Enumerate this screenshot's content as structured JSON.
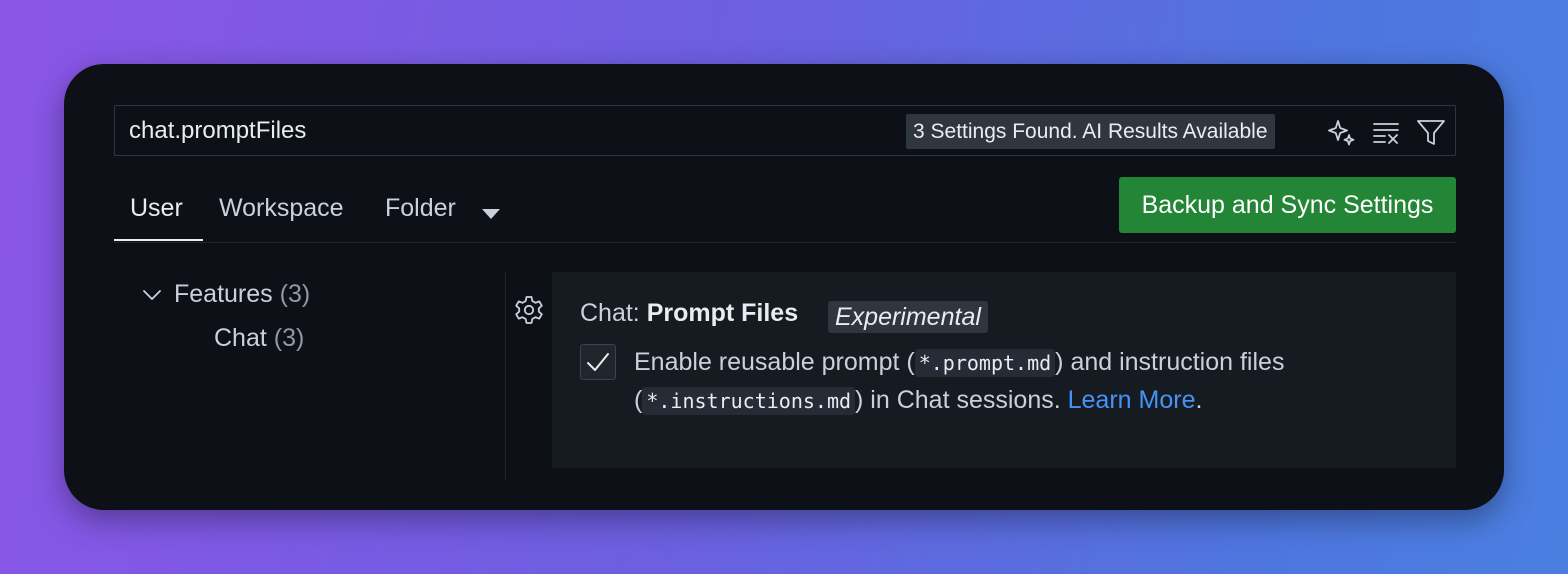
{
  "search": {
    "value": "chat.promptFiles",
    "results_label": "3 Settings Found. AI Results Available",
    "icons": [
      "sparkle-icon",
      "clear-filter-icon",
      "filter-icon"
    ]
  },
  "tabs": [
    {
      "label": "User",
      "active": true
    },
    {
      "label": "Workspace",
      "active": false
    },
    {
      "label": "Folder",
      "active": false
    }
  ],
  "sync_button": {
    "label": "Backup and Sync Settings",
    "color": "#238636"
  },
  "tree": {
    "items": [
      {
        "label": "Features",
        "count": "(3)",
        "expanded": true
      },
      {
        "label": "Chat",
        "count": "(3)"
      }
    ]
  },
  "setting": {
    "category": "Chat: ",
    "name": "Prompt Files",
    "tag": "Experimental",
    "checked": true,
    "desc_part1": "Enable reusable prompt (",
    "code1": "*.prompt.md",
    "desc_part2": ") and instruction files (",
    "code2": "*.instructions.md",
    "desc_part3": ") in Chat sessions. ",
    "link_text": "Learn More",
    "desc_end": "."
  },
  "colors": {
    "accent_link": "#4493f8",
    "button_green": "#238636",
    "background": "#0d1117"
  }
}
